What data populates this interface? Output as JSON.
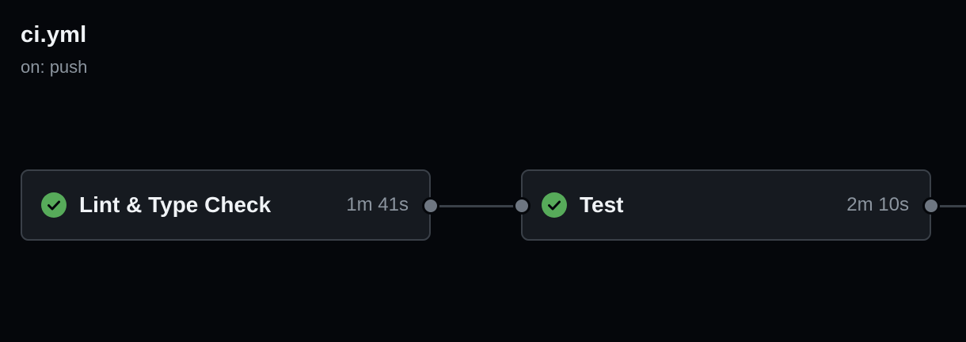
{
  "workflow": {
    "file_name": "ci.yml",
    "trigger": "on: push"
  },
  "jobs": [
    {
      "name": "Lint & Type Check",
      "duration": "1m 41s",
      "status": "success",
      "status_icon": "check-circle-icon"
    },
    {
      "name": "Test",
      "duration": "2m 10s",
      "status": "success",
      "status_icon": "check-circle-icon"
    }
  ],
  "colors": {
    "background": "#05070b",
    "card_background": "#161a20",
    "card_border": "#3a4048",
    "success": "#57ab5a",
    "text_primary": "#f0f3f6",
    "text_secondary": "#8b949e",
    "port": "#6e7681"
  }
}
